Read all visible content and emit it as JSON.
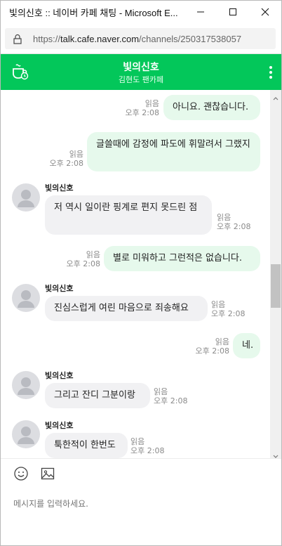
{
  "window": {
    "title": "빛의신호 :: 네이버 카페 채팅 - Microsoft E...",
    "url_prefix": "https://",
    "url_host": "talk.cafe.naver.com",
    "url_path": "/channels/250317538057"
  },
  "header": {
    "title": "빛의신호",
    "subtitle": "김현도 팬카페",
    "accent": "#03c75a"
  },
  "messages": [
    {
      "side": "mine",
      "text": "아니요. 괜찮습니다.",
      "read": "읽음",
      "time": "오후 2:08"
    },
    {
      "side": "mine",
      "text": "글쓸때에 감정에 파도에 휘말려서 그랬지",
      "read": "읽음",
      "time": "오후 2:08"
    },
    {
      "side": "theirs",
      "sender": "빛의신호",
      "text": "저 역시 일이란 핑계로 편지 못드린 점",
      "read": "읽음",
      "time": "오후 2:08"
    },
    {
      "side": "mine",
      "text": "별로 미워하고 그런적은 없습니다.",
      "read": "읽음",
      "time": "오후 2:08"
    },
    {
      "side": "theirs",
      "sender": "빛의신호",
      "text": "진심스럽게 여린 마음으로 죄송해요",
      "read": "읽음",
      "time": "오후 2:08"
    },
    {
      "side": "mine",
      "text": "네.",
      "read": "읽음",
      "time": "오후 2:08"
    },
    {
      "side": "theirs",
      "sender": "빛의신호",
      "text": "그리고 잔디 그분이랑",
      "read": "읽음",
      "time": "오후 2:08"
    },
    {
      "side": "theirs",
      "sender": "빛의신호",
      "text": "툭한적이 한번도",
      "read": "읽음",
      "time": "오후 2:08"
    }
  ],
  "composer": {
    "placeholder": "메시지를 입력하세요.",
    "value": ""
  },
  "icons": {
    "lock": "lock-icon",
    "cafe": "cafe-cup-icon",
    "menu": "more-vertical-icon",
    "emoji": "emoji-icon",
    "image": "image-icon"
  }
}
